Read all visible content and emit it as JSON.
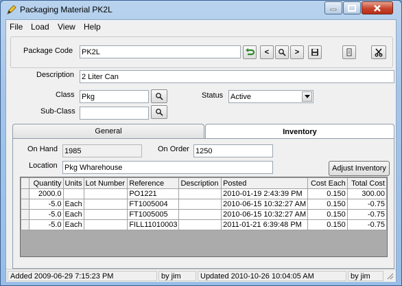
{
  "window": {
    "title": "Packaging Material PK2L",
    "min_glyph": "–",
    "max_glyph": "□",
    "close_glyph": "✕"
  },
  "menu": [
    "File",
    "Load",
    "View",
    "Help"
  ],
  "header": {
    "package_code_label": "Package Code",
    "package_code_value": "PK2L"
  },
  "toolbar": {
    "nav_prev_glyph": "<",
    "nav_next_glyph": ">"
  },
  "details": {
    "description_label": "Description",
    "description_value": "2 Liter Can",
    "class_label": "Class",
    "class_value": "Pkg",
    "subclass_label": "Sub-Class",
    "subclass_value": "",
    "status_label": "Status",
    "status_value": "Active"
  },
  "tabs": {
    "general": "General",
    "inventory": "Inventory"
  },
  "inventory": {
    "on_hand_label": "On Hand",
    "on_hand_value": "1985",
    "on_order_label": "On Order",
    "on_order_value": "1250",
    "location_label": "Location",
    "location_value": "Pkg Wharehouse",
    "adjust_button": "Adjust Inventory"
  },
  "grid": {
    "columns": [
      "Quantity",
      "Units",
      "Lot Number",
      "Reference",
      "Description",
      "Posted",
      "Cost Each",
      "Total Cost"
    ],
    "rows": [
      [
        "2000.0",
        "",
        "",
        "PO1221",
        "",
        "2010-01-19 2:43:39 PM",
        "0.150",
        "300.00"
      ],
      [
        "-5.0",
        "Each",
        "",
        "FT1005004",
        "",
        "2010-06-15 10:32:27 AM",
        "0.150",
        "-0.75"
      ],
      [
        "-5.0",
        "Each",
        "",
        "FT1005005",
        "",
        "2010-06-15 10:32:27 AM",
        "0.150",
        "-0.75"
      ],
      [
        "-5.0",
        "Each",
        "",
        "FILL11010003",
        "",
        "2011-01-21 6:39:48 PM",
        "0.150",
        "-0.75"
      ]
    ]
  },
  "status": {
    "added": "Added 2009-06-29 7:15:23 PM",
    "added_by": "by jim",
    "updated": "Updated 2010-10-26 10:04:05 AM",
    "updated_by": "by jim"
  },
  "colors": {
    "accent_green": "#2e8b2e",
    "title_bar": "#a5c5e8",
    "close_red": "#c7452d"
  }
}
